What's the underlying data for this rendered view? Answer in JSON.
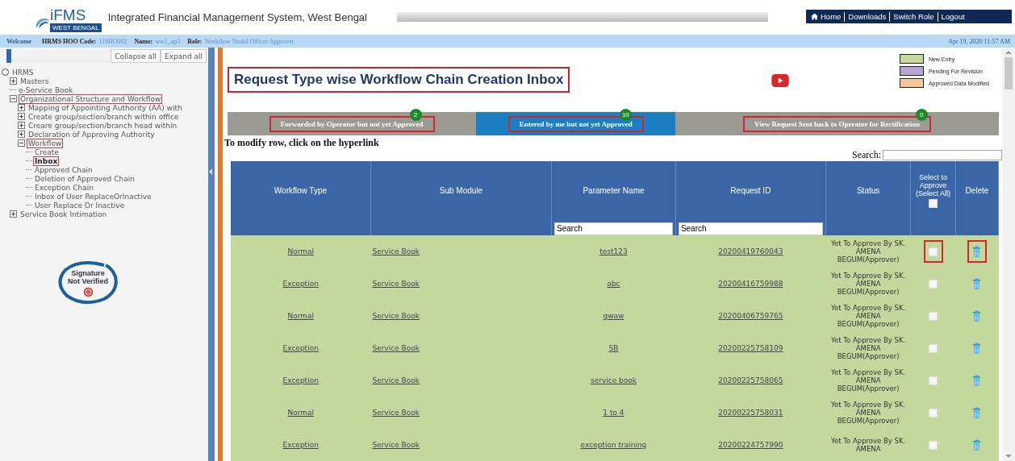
{
  "header": {
    "logo_text": "iFMS",
    "logo_sub": "WEST BENGAL",
    "title": "Integrated Financial Management System, West Bengal",
    "nav": [
      {
        "label": "Home",
        "kind": "home"
      },
      {
        "label": "Downloads",
        "kind": "link"
      },
      {
        "label": "Switch Role",
        "kind": "link"
      },
      {
        "label": "Logout",
        "kind": "link"
      }
    ]
  },
  "info_bar": {
    "welcome": "Welcome",
    "code_label": "HRMS HOO Code:",
    "code": "118HO002",
    "name_label": "Name:",
    "name": "ww1_ap3",
    "role_label": "Role:",
    "role": "Workflow Nodal Officer Approver",
    "datetime": "Apr 19, 2020 11:57 AM"
  },
  "sidebar": {
    "buttons": [
      "Collapse all",
      "Expand all"
    ],
    "tree": [
      {
        "label": "HRMS",
        "kind": "root",
        "highlighted": false,
        "selected": false,
        "children": [
          {
            "label": "Masters",
            "kind": "folder",
            "expanded": false,
            "highlighted": false,
            "selected": false
          },
          {
            "label": "e-Service Book",
            "kind": "leaf",
            "highlighted": false,
            "selected": false
          },
          {
            "label": "Organizational Structure and Workflow",
            "kind": "folder",
            "expanded": true,
            "highlighted": true,
            "selected": false,
            "children": [
              {
                "label": "Mapping of Appointing Authority (AA) with",
                "kind": "folder",
                "expanded": false,
                "highlighted": false,
                "selected": false
              },
              {
                "label": "Create group/section/branch within office",
                "kind": "folder",
                "expanded": false,
                "highlighted": false,
                "selected": false
              },
              {
                "label": "Creare group/section/branch head within",
                "kind": "folder",
                "expanded": false,
                "highlighted": false,
                "selected": false
              },
              {
                "label": "Declaration of Approving Authority",
                "kind": "folder",
                "expanded": false,
                "highlighted": false,
                "selected": false
              },
              {
                "label": "Workflow",
                "kind": "folder",
                "expanded": true,
                "highlighted": true,
                "selected": false,
                "children": [
                  {
                    "label": "Create",
                    "kind": "leaf",
                    "highlighted": false,
                    "selected": false
                  },
                  {
                    "label": "Inbox",
                    "kind": "leaf",
                    "highlighted": true,
                    "selected": true
                  },
                  {
                    "label": "Approved Chain",
                    "kind": "leaf",
                    "highlighted": false,
                    "selected": false
                  },
                  {
                    "label": "Deletion of Approved Chain",
                    "kind": "leaf",
                    "highlighted": false,
                    "selected": false
                  },
                  {
                    "label": "Exception Chain",
                    "kind": "leaf",
                    "highlighted": false,
                    "selected": false
                  },
                  {
                    "label": "Inbox of User ReplaceOrInactive",
                    "kind": "leaf",
                    "highlighted": false,
                    "selected": false
                  },
                  {
                    "label": "User Replace Or Inactive",
                    "kind": "leaf",
                    "highlighted": false,
                    "selected": false
                  }
                ]
              }
            ]
          },
          {
            "label": "Service Book Intimation",
            "kind": "folder",
            "expanded": false,
            "highlighted": false,
            "selected": false
          }
        ]
      }
    ],
    "signature": {
      "line1": "Signature",
      "line2": "Not Verified"
    }
  },
  "page_title": "Request Type wise Workflow Chain Creation Inbox",
  "legend": [
    {
      "label": "New Entry",
      "color": "#c5d99f"
    },
    {
      "label": "Pending For Revision",
      "color": "#b3a5d4"
    },
    {
      "label": "Approved Data Modified",
      "color": "#f8c69a"
    }
  ],
  "tabs": [
    {
      "label": "Forwarded by Operator but not yet Approved",
      "count": "2",
      "selected": false
    },
    {
      "label": "Entered by me but not yet Approved",
      "count": "10",
      "selected": true
    },
    {
      "label": "View Request Sent back to Operator for Rectification",
      "count": "0",
      "selected": false
    }
  ],
  "note": "To modify row, click on the hyperlink",
  "search_label": "Search:",
  "table": {
    "columns": [
      {
        "label": "Workflow Type"
      },
      {
        "label": "Sub Module"
      },
      {
        "label": "Parameter Name",
        "filter": "Search"
      },
      {
        "label": "Request ID",
        "filter": "Search"
      },
      {
        "label": "Status"
      },
      {
        "label": "Select to Approve (Select All)",
        "kind": "select_all",
        "checked": false
      },
      {
        "label": "Delete"
      }
    ],
    "rows": [
      {
        "workflow_type": "Normal",
        "sub_module": "Service Book",
        "parameter": "test123",
        "request_id": "20200419760043",
        "status": "Yet To Approve By SK. AMENA BEGUM(Approver)",
        "checked": false,
        "highlighted": true
      },
      {
        "workflow_type": "Exception",
        "sub_module": "Service Book",
        "parameter": "abc",
        "request_id": "20200416759988",
        "status": "Yet To Approve By SK. AMENA BEGUM(Approver)",
        "checked": false,
        "highlighted": false
      },
      {
        "workflow_type": "Normal",
        "sub_module": "Service Book",
        "parameter": "qwaw",
        "request_id": "20200406759765",
        "status": "Yet To Approve By SK. AMENA BEGUM(Approver)",
        "checked": false,
        "highlighted": false
      },
      {
        "workflow_type": "Exception",
        "sub_module": "Service Book",
        "parameter": "SB",
        "request_id": "20200225758109",
        "status": "Yet To Approve By SK. AMENA BEGUM(Approver)",
        "checked": false,
        "highlighted": false
      },
      {
        "workflow_type": "Exception",
        "sub_module": "Service Book",
        "parameter": "service book",
        "request_id": "20200225758065",
        "status": "Yet To Approve By SK. AMENA BEGUM(Approver)",
        "checked": false,
        "highlighted": false
      },
      {
        "workflow_type": "Normal",
        "sub_module": "Service Book",
        "parameter": "1 to 4",
        "request_id": "20200225758031",
        "status": "Yet To Approve By SK. AMENA BEGUM(Approver)",
        "checked": false,
        "highlighted": false
      },
      {
        "workflow_type": "Exception",
        "sub_module": "Service Book",
        "parameter": "exception training",
        "request_id": "20200224757990",
        "status": "Yet To Approve By SK. AMENA",
        "checked": false,
        "highlighted": false
      }
    ]
  }
}
